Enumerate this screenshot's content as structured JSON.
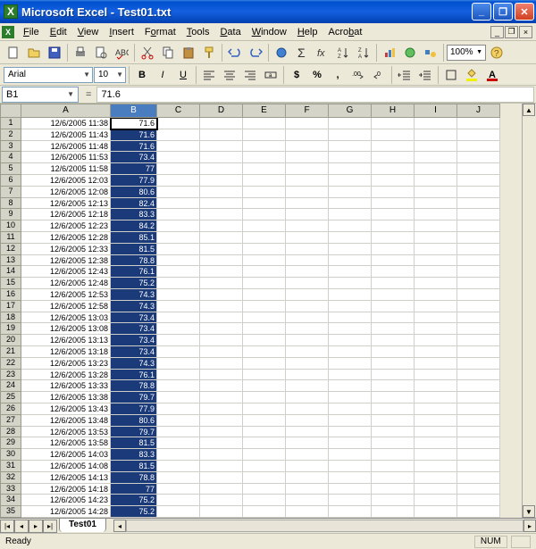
{
  "window": {
    "title": "Microsoft Excel - Test01.txt"
  },
  "menu": {
    "file": "File",
    "edit": "Edit",
    "view": "View",
    "insert": "Insert",
    "format": "Format",
    "tools": "Tools",
    "data": "Data",
    "window": "Window",
    "help": "Help",
    "acrobat": "Acrobat"
  },
  "toolbar": {
    "zoom": "100%"
  },
  "format": {
    "font": "Arial",
    "size": "10"
  },
  "formula": {
    "name": "B1",
    "eq": "=",
    "value": "71.6"
  },
  "columns": [
    "A",
    "B",
    "C",
    "D",
    "E",
    "F",
    "G",
    "H",
    "I",
    "J"
  ],
  "colwidths": {
    "A": 100,
    "B": 52,
    "other": 48
  },
  "selected_column": "B",
  "active_cell": {
    "row": 1,
    "col": "B"
  },
  "rows": [
    {
      "n": 1,
      "A": "12/6/2005 11:38",
      "B": "71.6"
    },
    {
      "n": 2,
      "A": "12/6/2005 11:43",
      "B": "71.6"
    },
    {
      "n": 3,
      "A": "12/6/2005 11:48",
      "B": "71.6"
    },
    {
      "n": 4,
      "A": "12/6/2005 11:53",
      "B": "73.4"
    },
    {
      "n": 5,
      "A": "12/6/2005 11:58",
      "B": "77"
    },
    {
      "n": 6,
      "A": "12/6/2005 12:03",
      "B": "77.9"
    },
    {
      "n": 7,
      "A": "12/6/2005 12:08",
      "B": "80.6"
    },
    {
      "n": 8,
      "A": "12/6/2005 12:13",
      "B": "82.4"
    },
    {
      "n": 9,
      "A": "12/6/2005 12:18",
      "B": "83.3"
    },
    {
      "n": 10,
      "A": "12/6/2005 12:23",
      "B": "84.2"
    },
    {
      "n": 11,
      "A": "12/6/2005 12:28",
      "B": "85.1"
    },
    {
      "n": 12,
      "A": "12/6/2005 12:33",
      "B": "81.5"
    },
    {
      "n": 13,
      "A": "12/6/2005 12:38",
      "B": "78.8"
    },
    {
      "n": 14,
      "A": "12/6/2005 12:43",
      "B": "76.1"
    },
    {
      "n": 15,
      "A": "12/6/2005 12:48",
      "B": "75.2"
    },
    {
      "n": 16,
      "A": "12/6/2005 12:53",
      "B": "74.3"
    },
    {
      "n": 17,
      "A": "12/6/2005 12:58",
      "B": "74.3"
    },
    {
      "n": 18,
      "A": "12/6/2005 13:03",
      "B": "73.4"
    },
    {
      "n": 19,
      "A": "12/6/2005 13:08",
      "B": "73.4"
    },
    {
      "n": 20,
      "A": "12/6/2005 13:13",
      "B": "73.4"
    },
    {
      "n": 21,
      "A": "12/6/2005 13:18",
      "B": "73.4"
    },
    {
      "n": 22,
      "A": "12/6/2005 13:23",
      "B": "74.3"
    },
    {
      "n": 23,
      "A": "12/6/2005 13:28",
      "B": "76.1"
    },
    {
      "n": 24,
      "A": "12/6/2005 13:33",
      "B": "78.8"
    },
    {
      "n": 25,
      "A": "12/6/2005 13:38",
      "B": "79.7"
    },
    {
      "n": 26,
      "A": "12/6/2005 13:43",
      "B": "77.9"
    },
    {
      "n": 27,
      "A": "12/6/2005 13:48",
      "B": "80.6"
    },
    {
      "n": 28,
      "A": "12/6/2005 13:53",
      "B": "79.7"
    },
    {
      "n": 29,
      "A": "12/6/2005 13:58",
      "B": "81.5"
    },
    {
      "n": 30,
      "A": "12/6/2005 14:03",
      "B": "83.3"
    },
    {
      "n": 31,
      "A": "12/6/2005 14:08",
      "B": "81.5"
    },
    {
      "n": 32,
      "A": "12/6/2005 14:13",
      "B": "78.8"
    },
    {
      "n": 33,
      "A": "12/6/2005 14:18",
      "B": "77"
    },
    {
      "n": 34,
      "A": "12/6/2005 14:23",
      "B": "75.2"
    },
    {
      "n": 35,
      "A": "12/6/2005 14:28",
      "B": "75.2"
    }
  ],
  "tabs": {
    "sheet": "Test01"
  },
  "status": {
    "ready": "Ready",
    "num": "NUM"
  }
}
